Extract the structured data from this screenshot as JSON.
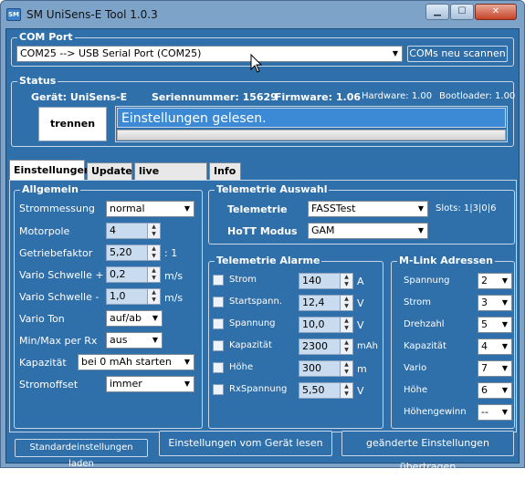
{
  "window": {
    "title": "SM UniSens-E Tool 1.0.3",
    "controls": {
      "minimize": "▁",
      "maximize": "☐",
      "close": "✕"
    },
    "icon_text": "SM"
  },
  "com_port": {
    "group_label": "COM Port",
    "selected": "COM25  --> USB Serial Port (COM25)",
    "scan_button": "COMs neu scannen"
  },
  "status": {
    "group_label": "Status",
    "device": "Gerät: UniSens-E",
    "serial": "Seriennummer: 15629",
    "firmware": "Firmware: 1.06",
    "hardware": "Hardware: 1.00",
    "bootloader": "Bootloader: 1.00",
    "disconnect_button": "trennen",
    "message": "Einstellungen gelesen."
  },
  "tabs": [
    {
      "label": "Einstellungen",
      "active": true
    },
    {
      "label": "Update",
      "active": false
    },
    {
      "label": "live Anzeige",
      "active": false
    },
    {
      "label": "Info",
      "active": false
    }
  ],
  "allgemein": {
    "group_label": "Allgemein",
    "strommessung": {
      "label": "Strommessung",
      "value": "normal"
    },
    "motorpole": {
      "label": "Motorpole",
      "value": "4"
    },
    "getriebefaktor": {
      "label": "Getriebefaktor",
      "value": "5,20",
      "suffix": ": 1"
    },
    "vario_plus": {
      "label": "Vario Schwelle +",
      "value": "0,2",
      "unit": "m/s"
    },
    "vario_minus": {
      "label": "Vario Schwelle -",
      "value": "1,0",
      "unit": "m/s"
    },
    "vario_ton": {
      "label": "Vario Ton",
      "value": "auf/ab"
    },
    "minmax": {
      "label": "Min/Max per Rx",
      "value": "aus"
    },
    "kapazitaet": {
      "label": "Kapazität",
      "value": "bei 0 mAh starten"
    },
    "stromoffset": {
      "label": "Stromoffset",
      "value": "immer"
    }
  },
  "telemetrie_auswahl": {
    "group_label": "Telemetrie Auswahl",
    "telemetrie": {
      "label": "Telemetrie",
      "value": "FASSTest"
    },
    "slots": "Slots: 1|3|0|6",
    "hott": {
      "label": "HoTT Modus",
      "value": "GAM"
    }
  },
  "telemetrie_alarme": {
    "group_label": "Telemetrie Alarme",
    "rows": [
      {
        "label": "Strom",
        "value": "140",
        "unit": "A"
      },
      {
        "label": "Startspann.",
        "value": "12,4",
        "unit": "V"
      },
      {
        "label": "Spannung",
        "value": "10,0",
        "unit": "V"
      },
      {
        "label": "Kapazität",
        "value": "2300",
        "unit": "mAh"
      },
      {
        "label": "Höhe",
        "value": "300",
        "unit": "m"
      },
      {
        "label": "RxSpannung",
        "value": "5,50",
        "unit": "V"
      }
    ]
  },
  "mlink": {
    "group_label": "M-Link Adressen",
    "rows": [
      {
        "label": "Spannung",
        "value": "2"
      },
      {
        "label": "Strom",
        "value": "3"
      },
      {
        "label": "Drehzahl",
        "value": "5"
      },
      {
        "label": "Kapazität",
        "value": "4"
      },
      {
        "label": "Vario",
        "value": "7"
      },
      {
        "label": "Höhe",
        "value": "6"
      },
      {
        "label": "Höhengewinn",
        "value": "--"
      }
    ]
  },
  "bottom": {
    "defaults_button": "Standardeinstellungen laden",
    "read_button": "Einstellungen vom Gerät lesen",
    "write_button": "geänderte Einstellungen übertragen"
  }
}
